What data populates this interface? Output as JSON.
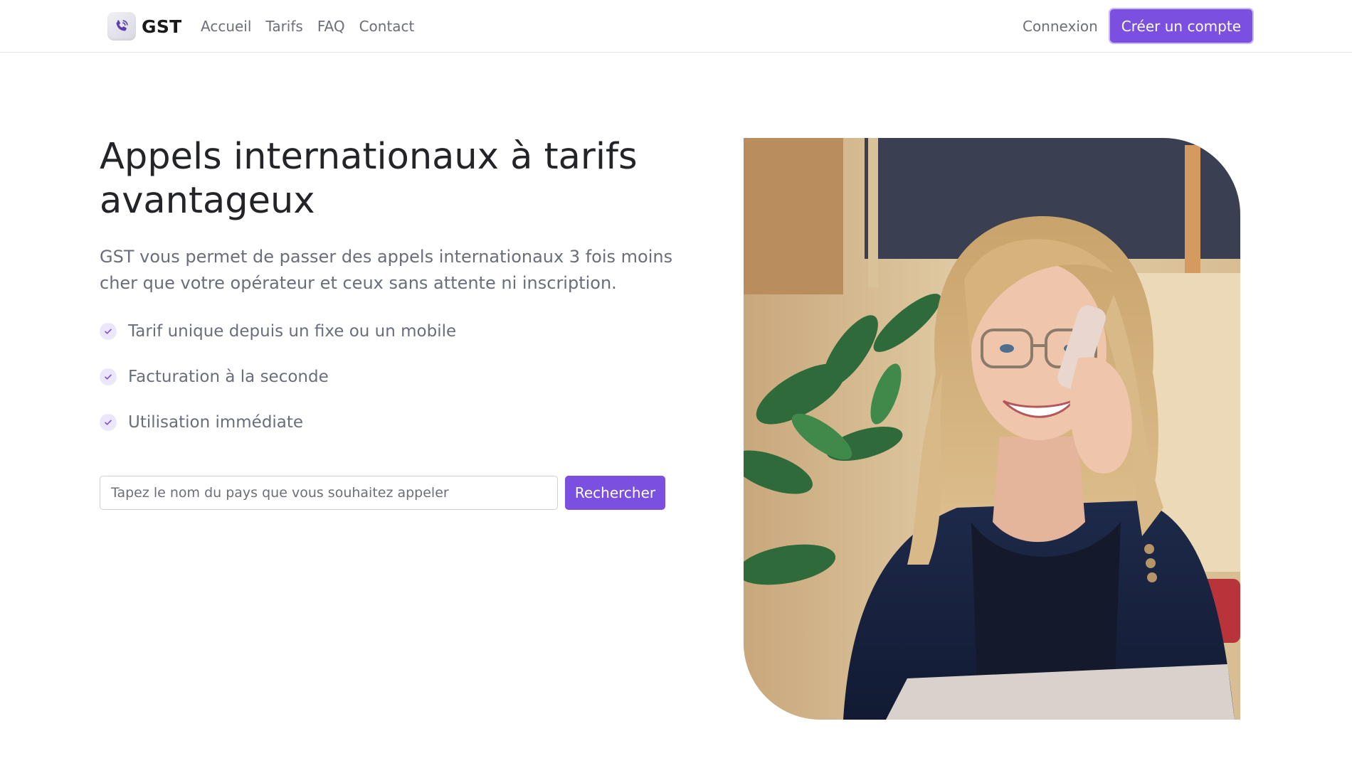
{
  "navbar": {
    "brand": {
      "name": "GST",
      "logo_icon": "phone-icon"
    },
    "links": [
      {
        "label": "Accueil"
      },
      {
        "label": "Tarifs"
      },
      {
        "label": "FAQ"
      },
      {
        "label": "Contact"
      }
    ],
    "login_label": "Connexion",
    "signup_label": "Créer un compte"
  },
  "hero": {
    "title": "Appels internationaux à tarifs avantageux",
    "lead": "GST vous permet de passer des appels internationaux 3 fois moins cher que votre opérateur et ceux sans attente ni inscription.",
    "features": [
      {
        "icon": "check-icon",
        "label": "Tarif unique depuis un fixe ou un mobile"
      },
      {
        "icon": "check-icon",
        "label": "Facturation à la seconde"
      },
      {
        "icon": "check-icon",
        "label": "Utilisation immédiate"
      }
    ],
    "search": {
      "placeholder": "Tapez le nom du pays que vous souhaitez appeler",
      "value": "",
      "button_label": "Rechercher"
    },
    "image": {
      "subject": "woman-on-phone-photo"
    }
  },
  "colors": {
    "accent": "#7b4fe0",
    "text_dark": "#222428",
    "text_muted": "#6a6e7a",
    "check_bg": "#ece6fb"
  }
}
